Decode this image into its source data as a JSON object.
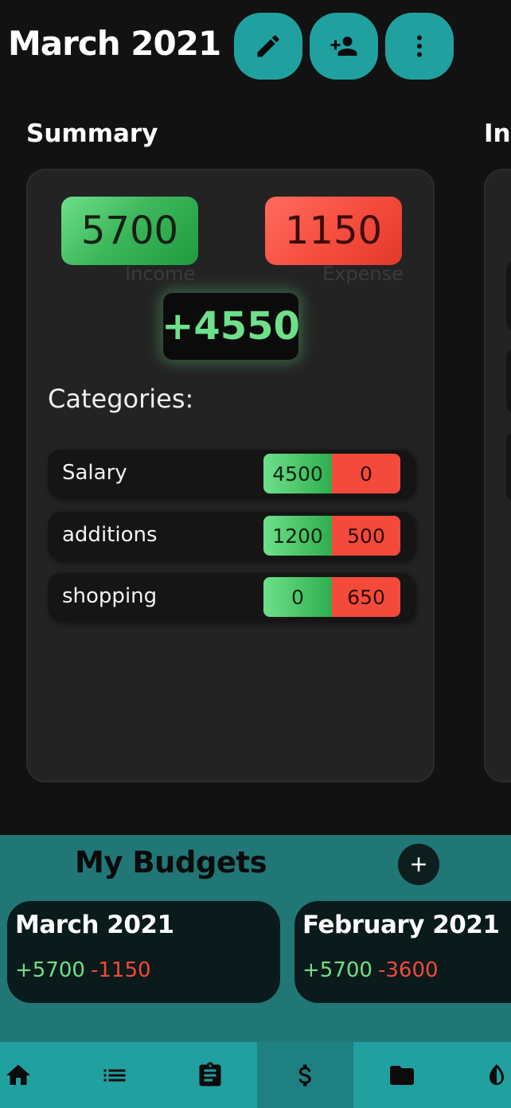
{
  "header": {
    "title": "March 2021",
    "actions": [
      {
        "icon": "pencil-icon"
      },
      {
        "icon": "add-person-icon"
      },
      {
        "icon": "more-vertical-icon"
      }
    ]
  },
  "summary": {
    "title": "Summary",
    "next_title_partial": "Inc",
    "income_value": "5700",
    "income_label": "Income",
    "expense_value": "1150",
    "expense_label": "Expense",
    "net": "+4550",
    "categories_label": "Categories:",
    "categories": [
      {
        "name": "Salary",
        "income": "4500",
        "expense": "0"
      },
      {
        "name": "additions",
        "income": "1200",
        "expense": "500"
      },
      {
        "name": "shopping",
        "income": "0",
        "expense": "650"
      }
    ]
  },
  "budgets": {
    "title": "My Budgets",
    "add_icon": "plus-icon",
    "items": [
      {
        "name": "March 2021",
        "income": "+5700",
        "expense": "-1150"
      },
      {
        "name": "February 2021",
        "income": "+5700",
        "expense": "-3600"
      }
    ]
  },
  "nav": {
    "items": [
      "home-icon",
      "list-icon",
      "clipboard-icon",
      "dollar-icon",
      "folder-icon",
      "contrast-icon"
    ],
    "active": "dollar-icon"
  },
  "colors": {
    "accent": "#21a0a0",
    "panel": "#217676",
    "income": "#6ee08a",
    "expense": "#f44a3b",
    "background": "#121212"
  }
}
